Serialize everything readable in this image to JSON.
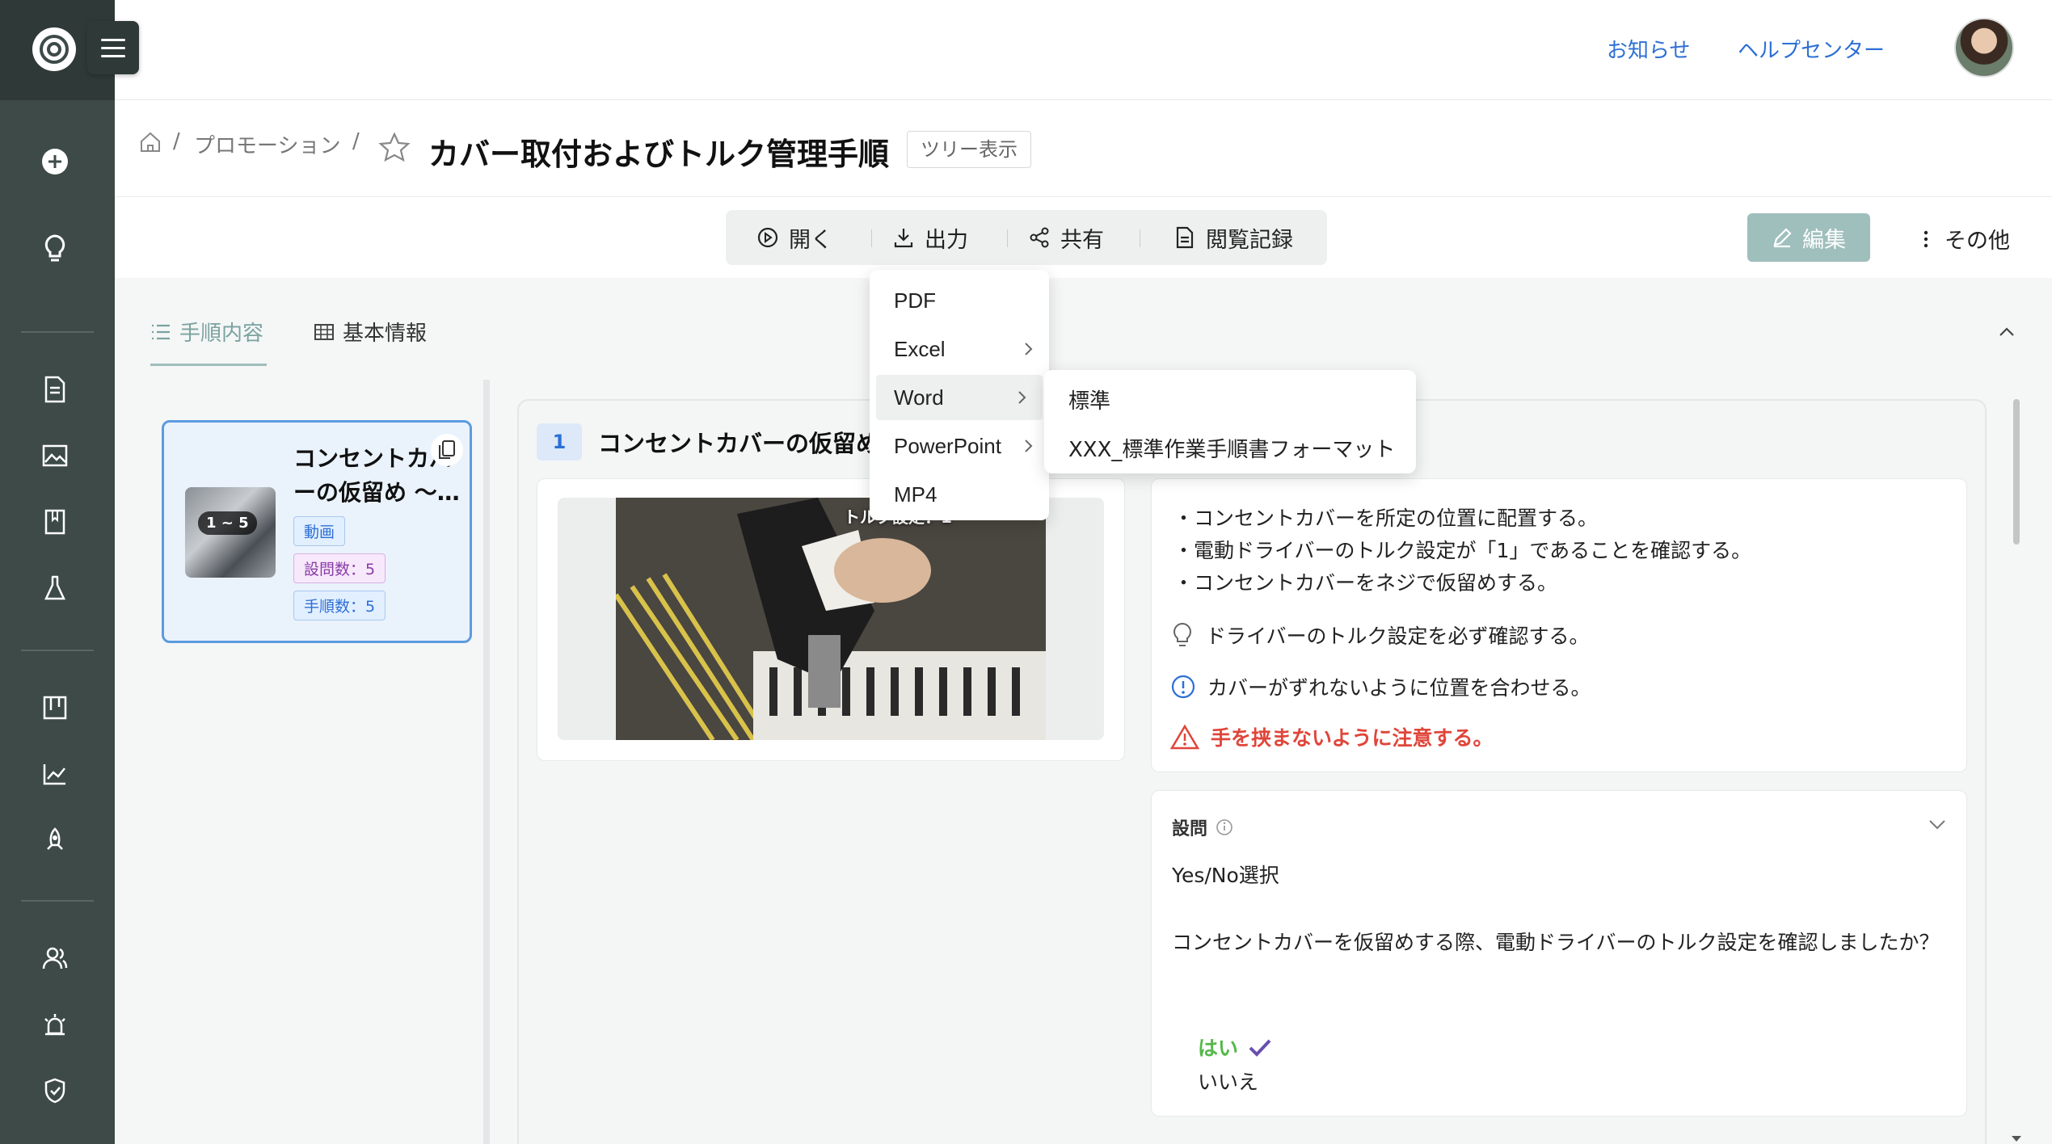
{
  "header": {
    "notice_link": "お知らせ",
    "help_link": "ヘルプセンター"
  },
  "breadcrumb": {
    "separator": "/",
    "folder": "プロモーション"
  },
  "page": {
    "title": "カバー取付およびトルク管理手順",
    "tree_button": "ツリー表示"
  },
  "toolbar": {
    "open": "開く",
    "export": "出力",
    "share": "共有",
    "history": "閲覧記録",
    "edit": "編集",
    "more": "その他"
  },
  "export_menu": {
    "items": [
      "PDF",
      "Excel",
      "Word",
      "PowerPoint",
      "MP4"
    ],
    "word_submenu": [
      "標準",
      "XXX_標準作業手順書フォーマット"
    ]
  },
  "tabs": {
    "steps": "手順内容",
    "basic": "基本情報"
  },
  "step_card": {
    "title": "コンセントカバーの仮留め 〜…",
    "range_badge": "1 ~ 5",
    "tag_video": "動画",
    "tag_questions": "設問数：5",
    "tag_steps": "手順数：5"
  },
  "step": {
    "number": "1",
    "title": "コンセントカバーの仮留め",
    "video_caption": "トルク設定：1",
    "bullets": [
      "・コンセントカバーを所定の位置に配置する。",
      "・電動ドライバーのトルク設定が「1」であることを確認する。",
      "・コンセントカバーをネジで仮留めする。"
    ],
    "tip": "ドライバーのトルク設定を必ず確認する。",
    "info": "カバーがずれないように位置を合わせる。",
    "warning": "手を挟まないように注意する。"
  },
  "question": {
    "label": "設問",
    "type": "Yes/No選択",
    "text": "コンセントカバーを仮留めする際、電動ドライバーのトルク設定を確認しましたか？",
    "option_yes": "はい",
    "option_no": "いいえ"
  },
  "colors": {
    "sidebar": "#3d4a48",
    "accent": "#9fbfbd",
    "link": "#2d6fd6",
    "warning": "#e0453a",
    "correct": "#55b84a"
  }
}
